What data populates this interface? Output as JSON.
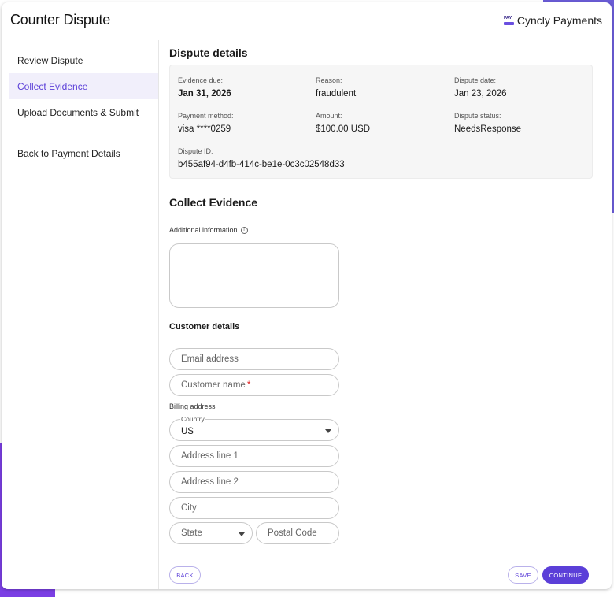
{
  "header": {
    "title": "Counter Dispute",
    "brand_name": "Cyncly Payments",
    "brand_badge": "PAY"
  },
  "sidebar": {
    "items": [
      {
        "label": "Review Dispute"
      },
      {
        "label": "Collect Evidence"
      },
      {
        "label": "Upload Documents & Submit"
      },
      {
        "label": "Back to Payment Details"
      }
    ],
    "active_index": 1
  },
  "dispute_details": {
    "title": "Dispute details",
    "evidence_due_label": "Evidence due:",
    "evidence_due_value": "Jan 31, 2026",
    "reason_label": "Reason:",
    "reason_value": "fraudulent",
    "dispute_date_label": "Dispute date:",
    "dispute_date_value": "Jan 23, 2026",
    "payment_method_label": "Payment method:",
    "payment_method_value": "visa ****0259",
    "amount_label": "Amount:",
    "amount_value": "$100.00 USD",
    "status_label": "Dispute status:",
    "status_value": "NeedsResponse",
    "id_label": "Dispute ID:",
    "id_value": "b455af94-d4fb-414c-be1e-0c3c02548d33"
  },
  "collect_evidence": {
    "title": "Collect Evidence",
    "additional_info_label": "Additional information",
    "info_icon_glyph": "i",
    "customer_details_label": "Customer details",
    "email_placeholder": "Email address",
    "name_placeholder": "Customer name",
    "required_mark": "*",
    "billing_address_label": "Billing address",
    "country_label": "Country",
    "country_value": "US",
    "address1_placeholder": "Address line 1",
    "address2_placeholder": "Address line 2",
    "city_placeholder": "City",
    "state_placeholder": "State",
    "postal_placeholder": "Postal Code"
  },
  "footer": {
    "back_label": "BACK",
    "save_label": "SAVE",
    "continue_label": "CONTINUE"
  },
  "colors": {
    "accent": "#5b3fd8",
    "active_nav_bg": "#f1effb",
    "required": "#e02020"
  }
}
